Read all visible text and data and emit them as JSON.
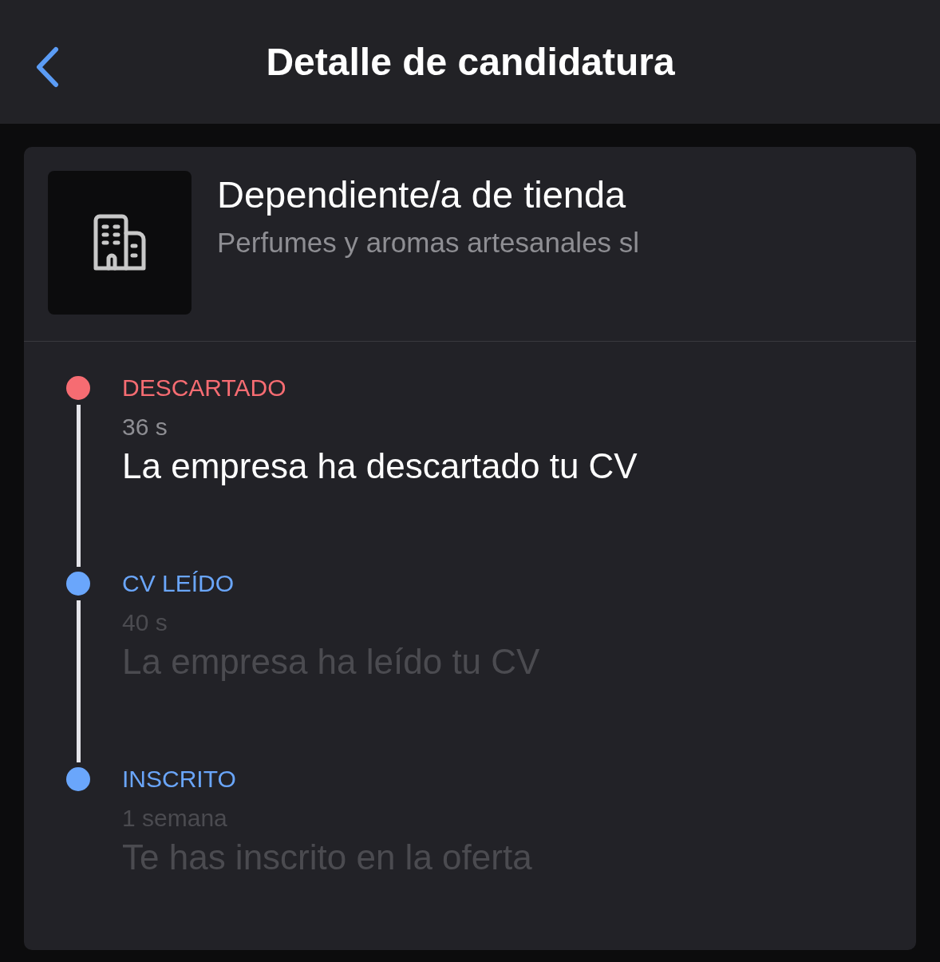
{
  "header": {
    "title": "Detalle de candidatura"
  },
  "job": {
    "title": "Dependiente/a de tienda",
    "company": "Perfumes y aromas artesanales sl"
  },
  "timeline": [
    {
      "status": "DESCARTADO",
      "color": "#f66c72",
      "time": "36 s",
      "description": "La empresa ha descartado tu CV",
      "current": true
    },
    {
      "status": "CV LEÍDO",
      "color": "#6aa6fb",
      "time": "40 s",
      "description": "La empresa ha leído tu CV",
      "current": false
    },
    {
      "status": "INSCRITO",
      "color": "#6aa6fb",
      "time": "1 semana",
      "description": "Te has inscrito en la oferta",
      "current": false
    }
  ]
}
